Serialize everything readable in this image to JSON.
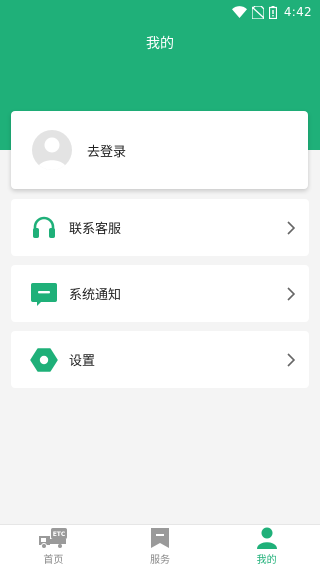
{
  "status_bar": {
    "time": "4:42"
  },
  "header": {
    "title": "我的"
  },
  "profile": {
    "login_label": "去登录"
  },
  "menu": [
    {
      "label": "联系客服",
      "icon": "headset-icon"
    },
    {
      "label": "系统通知",
      "icon": "message-icon"
    },
    {
      "label": "设置",
      "icon": "settings-hexagon-icon"
    }
  ],
  "tabbar": [
    {
      "label": "首页",
      "icon": "etc-truck-icon",
      "active": false
    },
    {
      "label": "服务",
      "icon": "bookmark-icon",
      "active": false
    },
    {
      "label": "我的",
      "icon": "person-icon",
      "active": true
    }
  ],
  "colors": {
    "accent": "#1fb079",
    "background": "#f4f4f4",
    "inactive": "#888888"
  }
}
